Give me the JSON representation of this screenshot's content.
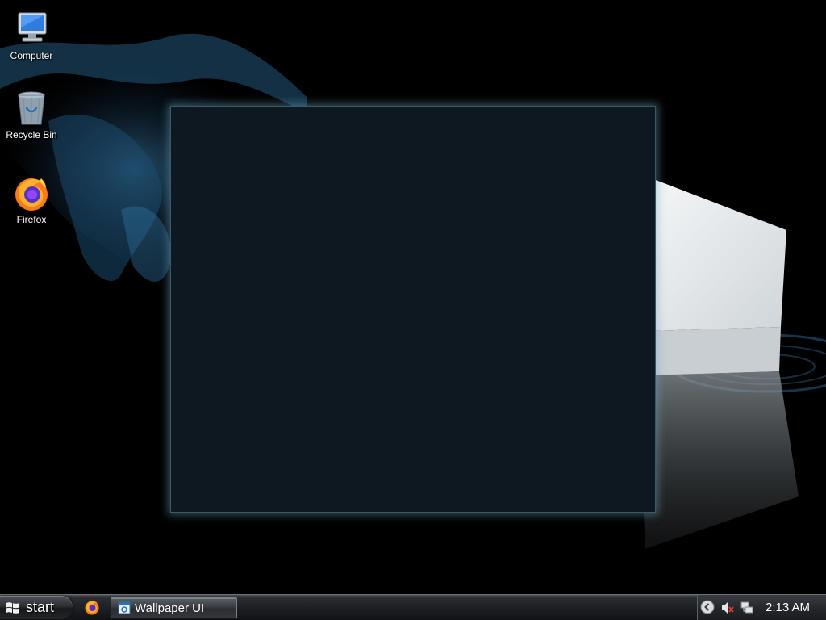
{
  "desktop": {
    "icons": [
      {
        "label": "Computer",
        "icon": "computer-icon"
      },
      {
        "label": "Recycle Bin",
        "icon": "recycle-bin-icon"
      },
      {
        "label": "Firefox",
        "icon": "firefox-icon"
      }
    ]
  },
  "taskbar": {
    "start_label": "start",
    "quick_launch": [
      {
        "icon": "firefox-icon"
      }
    ],
    "tasks": [
      {
        "label": "Wallpaper UI",
        "icon": "window-app-icon"
      }
    ],
    "tray": {
      "clock": "2:13 AM",
      "icons": [
        "show-hidden-icons-chevron-icon",
        "volume-muted-icon",
        "network-icon"
      ]
    }
  },
  "colors": {
    "desktop_bg": "#000000",
    "window_bg": "#0d1820",
    "window_glow": "#6eaac8",
    "taskbar_bg": "#1d2024"
  }
}
